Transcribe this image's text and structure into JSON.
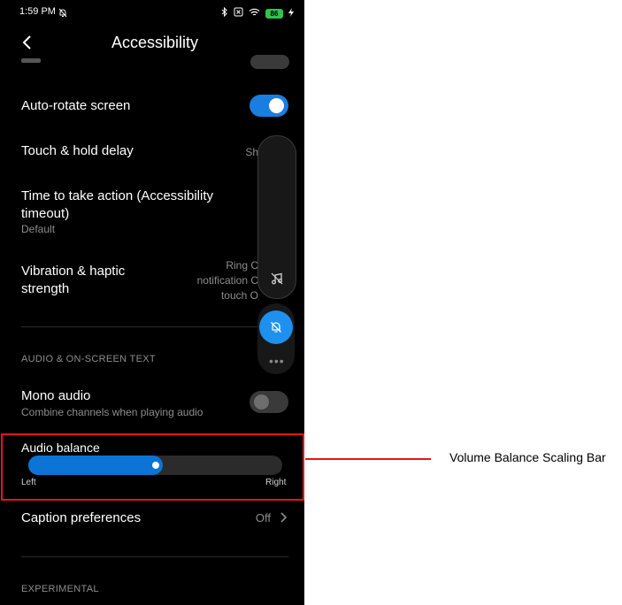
{
  "status_bar": {
    "time": "1:59 PM",
    "battery": "86"
  },
  "header": {
    "title": "Accessibility"
  },
  "rows": {
    "auto_rotate": {
      "title": "Auto-rotate screen",
      "enabled": true
    },
    "touch_hold": {
      "title": "Touch & hold delay",
      "value": "Sh"
    },
    "timeout": {
      "title_line1": "Time to take action (Accessibility",
      "title_line2": "timeout)",
      "subtitle": "Default"
    },
    "vibration": {
      "title_line1": "Vibration & haptic",
      "title_line2": "strength",
      "value_line1": "Ring C",
      "value_line2": "notification C",
      "value_line3": "touch O"
    }
  },
  "sections": {
    "audio": "AUDIO & ON-SCREEN TEXT",
    "experimental": "EXPERIMENTAL"
  },
  "mono_audio": {
    "title": "Mono audio",
    "subtitle": "Combine channels when playing audio",
    "enabled": false
  },
  "audio_balance": {
    "title": "Audio balance",
    "left_label": "Left",
    "right_label": "Right",
    "value": 0.5
  },
  "caption": {
    "title": "Caption preferences",
    "value": "Off"
  },
  "volume_panel": {
    "more": "•••"
  },
  "annotation": {
    "label": "Volume Balance Scaling Bar",
    "color": "#e8141a"
  },
  "colors": {
    "accent": "#1a7de0",
    "volume_button": "#1e90f0"
  }
}
